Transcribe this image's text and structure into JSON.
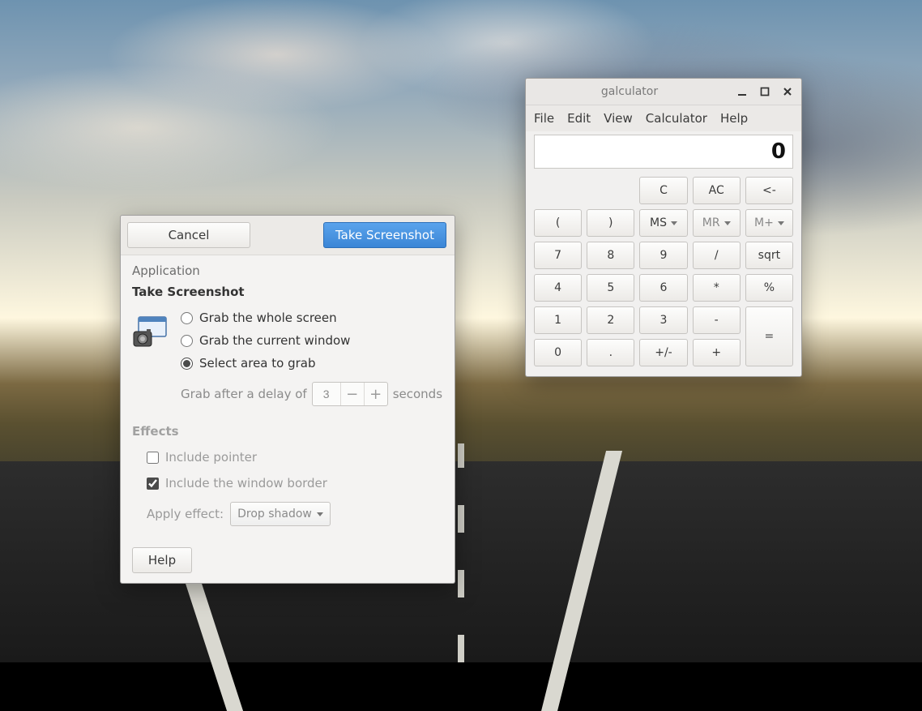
{
  "calculator": {
    "title": "galculator",
    "menu": {
      "file": "File",
      "edit": "Edit",
      "view": "View",
      "calculator": "Calculator",
      "help": "Help"
    },
    "display": "0",
    "clear": {
      "c": "C",
      "ac": "AC",
      "back": "<-"
    },
    "paren": {
      "open": "(",
      "close": ")"
    },
    "mem": {
      "ms": "MS",
      "mr": "MR",
      "mplus": "M+"
    },
    "keys": {
      "k7": "7",
      "k8": "8",
      "k9": "9",
      "div": "/",
      "sqrt": "sqrt",
      "k4": "4",
      "k5": "5",
      "k6": "6",
      "mul": "*",
      "pct": "%",
      "k1": "1",
      "k2": "2",
      "k3": "3",
      "sub": "-",
      "k0": "0",
      "dot": ".",
      "sign": "+/-",
      "add": "+",
      "eq": "="
    }
  },
  "screenshot": {
    "cancel": "Cancel",
    "take": "Take Screenshot",
    "application": "Application",
    "heading": "Take Screenshot",
    "radio1": "Grab the whole screen",
    "radio2": "Grab the current window",
    "radio3": "Select area to grab",
    "selected_radio": "radio3",
    "delay_prefix": "Grab after a delay of",
    "delay_value": "3",
    "delay_suffix": "seconds",
    "effects": "Effects",
    "include_pointer": "Include pointer",
    "include_pointer_checked": false,
    "include_border": "Include the window border",
    "include_border_checked": true,
    "apply_effect_label": "Apply effect:",
    "apply_effect_value": "Drop shadow",
    "help": "Help"
  }
}
